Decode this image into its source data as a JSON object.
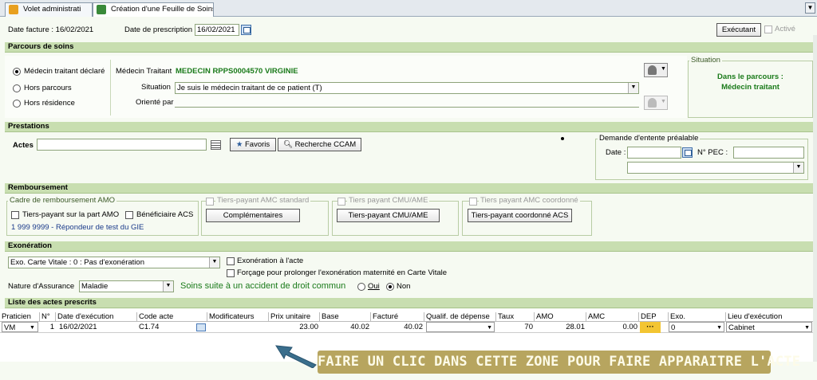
{
  "tabs": [
    {
      "label": "Volet administrati",
      "active": false
    },
    {
      "label": "Création d'une Feuille de Soins",
      "active": true
    }
  ],
  "header": {
    "date_facture_label": "Date facture : 16/02/2021",
    "date_prescription_label": "Date de prescription :",
    "date_prescription_value": "16/02/2021",
    "executant_button": "Exécutant",
    "actif_label": "Activé"
  },
  "parcours": {
    "section_title": "Parcours de soins",
    "radios": [
      {
        "label": "Médecin traitant déclaré",
        "selected": true
      },
      {
        "label": "Hors parcours",
        "selected": false
      },
      {
        "label": "Hors résidence",
        "selected": false
      }
    ],
    "medecin_label": "Médecin Traitant",
    "medecin_value": "MEDECIN RPPS0004570 VIRGINIE",
    "situation_label": "Situation",
    "situation_value": "Je suis le médecin traitant de ce patient (T)",
    "oriente_label": "Orienté par",
    "oriente_value": "",
    "situation_box_title": "Situation",
    "situation_status_line1": "Dans le parcours :",
    "situation_status_line2": "Médecin traitant"
  },
  "prestations": {
    "section_title": "Prestations",
    "actes_label": "Actes",
    "actes_value": "",
    "favoris_button": "Favoris",
    "recherche_button": "Recherche CCAM",
    "entente_title": "Demande d'entente préalable",
    "date_label": "Date :",
    "date_value": "",
    "npec_label": "N° PEC :",
    "npec_value": "",
    "entente_select": ""
  },
  "remboursement": {
    "section_title": "Remboursement",
    "amo_title": "Cadre de remboursement AMO",
    "tiers_amo_label": "Tiers-payant sur la part AMO",
    "acs_label": "Bénéficiaire ACS",
    "amo_info": "1 999 9999 - Répondeur de test du GIE",
    "amc_standard_title": "Tiers-payant AMC standard",
    "complementaires_button": "Complémentaires",
    "cmu_title": "Tiers payant CMU/AME",
    "cmu_button": "Tiers-payant CMU/AME",
    "coord_title": "Tiers payant AMC coordonné",
    "coord_button": "Tiers-payant coordonné ACS"
  },
  "exoneration": {
    "section_title": "Exonération",
    "select_value": "Exo. Carte Vitale : 0 : Pas d'exonération",
    "exo_acte_label": "Exonération à l'acte",
    "forcage_label": "Forçage pour prolonger l'exonération maternité en Carte Vitale",
    "nature_label": "Nature d'Assurance",
    "nature_value": "Maladie",
    "accident_label": "Soins suite à un accident de droit commun",
    "oui_label": "Oui",
    "non_label": "Non",
    "accident_selected": "Non"
  },
  "actes_list": {
    "section_title": "Liste des actes prescrits",
    "columns": [
      "Praticien",
      "N°",
      "Date d'exécution",
      "Code acte",
      "Modificateurs",
      "Prix unitaire",
      "Base",
      "Facturé",
      "Qualif. de dépense",
      "Taux",
      "AMO",
      "AMC",
      "DEP",
      "Exo.",
      "Lieu d'exécution"
    ],
    "rows": [
      {
        "praticien": "VM",
        "num": "1",
        "date": "16/02/2021",
        "code": "C1.74",
        "modificateurs": "",
        "prix": "23.00",
        "base": "40.02",
        "facture": "40.02",
        "qualif": "",
        "taux": "70",
        "amo": "28.01",
        "amc": "0.00",
        "dep": "···",
        "exo": "0",
        "lieu": "Cabinet"
      }
    ]
  },
  "annotation": {
    "text": "FAIRE UN CLIC DANS CETTE ZONE POUR FAIRE APPARAITRE L'ACTE",
    "arrow_color": "#3a6e8c",
    "banner_color": "#b7a55f"
  },
  "colors": {
    "section_bg": "#c8deb0",
    "accent_green": "#1a7a1a",
    "panel_bg": "#f6faf2"
  }
}
